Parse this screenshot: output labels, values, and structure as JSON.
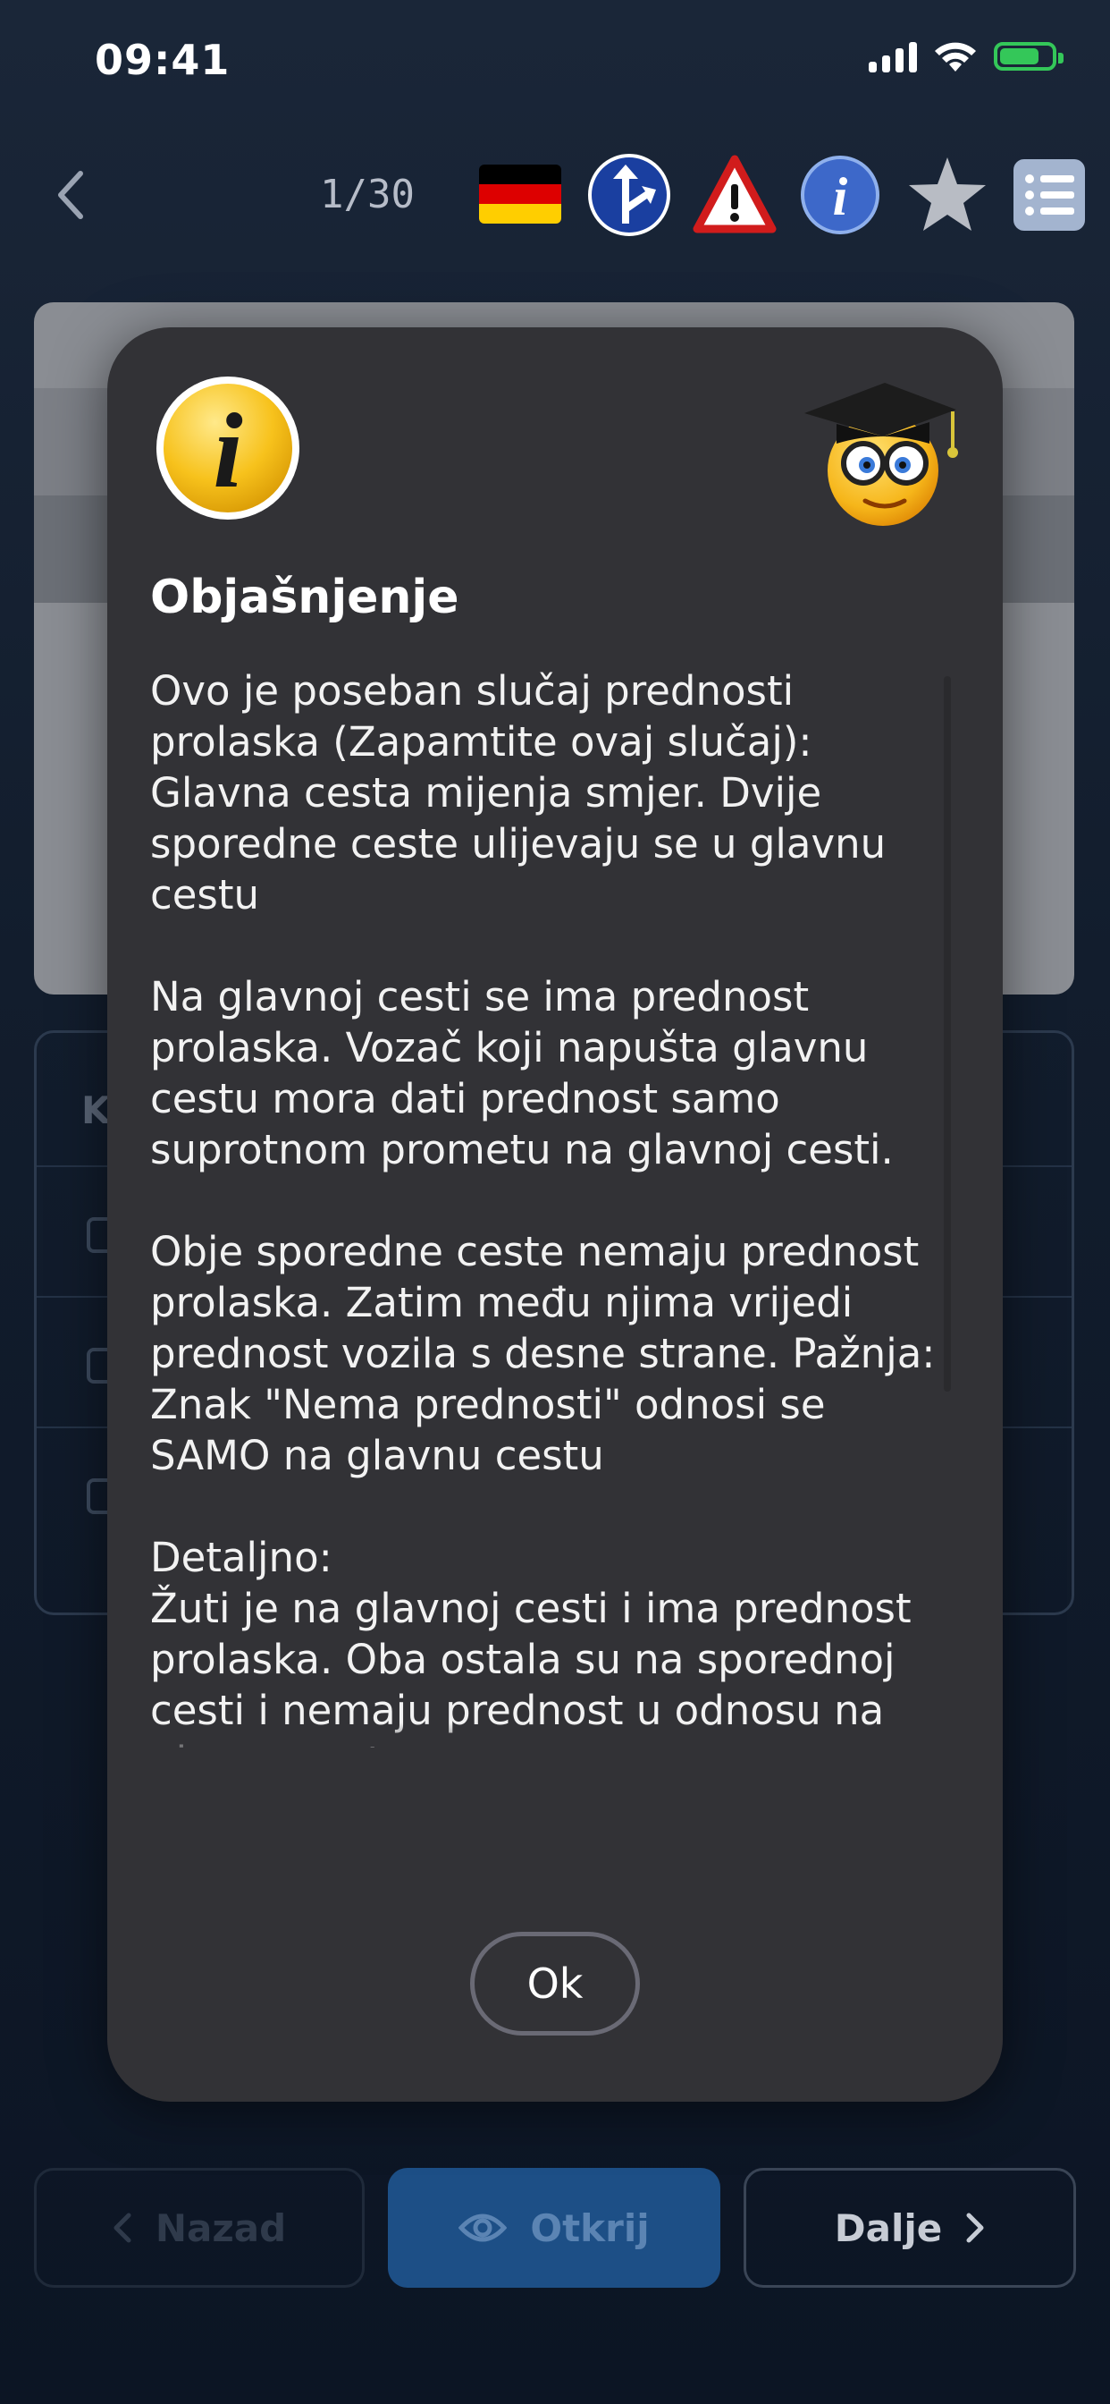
{
  "status_bar": {
    "time": "09:41"
  },
  "header": {
    "counter": "1/30",
    "icons": [
      "back-chevron-icon",
      "german-flag-icon",
      "priority-road-icon",
      "warning-triangle-icon",
      "info-icon",
      "star-icon",
      "list-icon"
    ],
    "flag_colors": [
      "#000000",
      "#dd0000",
      "#ffce00"
    ]
  },
  "background": {
    "answers_header_letter": "K"
  },
  "bottom_buttons": {
    "back_label": "Nazad",
    "reveal_label": "Otkrij",
    "next_label": "Dalje"
  },
  "modal": {
    "title": "Objašnjenje",
    "body": "Ovo je poseban slučaj prednosti prolaska (Zapamtite ovaj slučaj): Glavna cesta mijenja smjer. Dvije sporedne ceste ulijevaju se u glavnu cestu\n\nNa glavnoj cesti se ima prednost prolaska. Vozač koji napušta glavnu cestu mora dati prednost samo suprotnom prometu na glavnoj cesti.\n\nObje sporedne ceste nemaju prednost prolaska. Zatim među njima vrijedi prednost vozila s desne strane. Pažnja: Znak \"Nema prednosti\" odnosi se SAMO na glavnu cestu\n\nDetaljno:\nŽuti je na glavnoj cesti i ima prednost prolaska. Oba ostala su na sporednoj cesti i nemaju prednost u odnosu na glavnu cestu.\n\nZnakovi i oznake služe tome da ova pravila učine jasno vidljivima i da",
    "ok_label": "Ok"
  },
  "colors": {
    "modal_bg": "#323236",
    "accent_blue": "#1d4f86",
    "battery_green": "#34c759"
  }
}
